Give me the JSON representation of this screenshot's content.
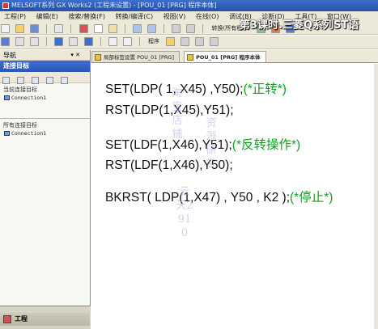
{
  "window": {
    "title": "MELSOFT系列 GX Works2 (工程未设置) - [POU_01 [PRG] 程序本体]"
  },
  "menu": [
    "工程(P)",
    "编辑(E)",
    "搜索/替换(F)",
    "转换/编译(C)",
    "视图(V)",
    "在线(O)",
    "调试(B)",
    "诊断(D)",
    "工具(T)",
    "窗口(W)"
  ],
  "overlay_title": "第3课时.三菱Q系列ST语",
  "toolbar_labels": {
    "row1": "转换(所有程序)",
    "row2": "程序"
  },
  "nav": {
    "header": "导航",
    "pin": "▾ ✕",
    "section_title": "连接目标",
    "current_label": "当前连接目标",
    "current_item": "Connection1",
    "all_label": "所有连接目标",
    "all_item": "Connection1",
    "project_label": "工程"
  },
  "tabs": [
    {
      "label": "局部标签设置 POU_01 [PRG]",
      "active": false
    },
    {
      "label": "POU_01 [PRG] 程序本体",
      "active": true
    }
  ],
  "code": [
    {
      "text": "SET(LDP( 1, X45) ,Y50);",
      "comment": "(*正转*)"
    },
    {
      "text": "RST(LDP(1,X45),Y51);",
      "comment": ""
    },
    {
      "text": "SET(LDF(1,X46),Y51);",
      "comment": "(*反转操作*)"
    },
    {
      "text": "RST(LDF(1,X46),Y50);",
      "comment": ""
    },
    {
      "text": "BKRST( LDP(1,X47) , Y50 , K2 );",
      "comment": "(*停止*)"
    }
  ],
  "watermark": {
    "column1": "淘宝店铺",
    "column2": "资源研究",
    "column3": "云天2910"
  },
  "colors": {
    "comment": "#10a020",
    "nav_section": "#2a56b4",
    "title_bar": "#2452a8"
  }
}
